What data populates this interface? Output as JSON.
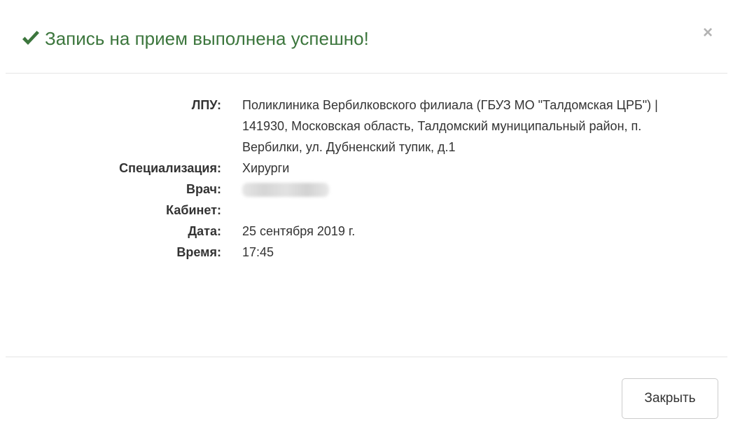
{
  "header": {
    "title": "Запись на прием выполнена успешно!",
    "close_symbol": "×",
    "title_color": "#3c763d"
  },
  "details": {
    "lpu": {
      "label": "ЛПУ:",
      "value": "Поликлиника Вербилковского филиала (ГБУЗ МО \"Талдомская ЦРБ\") | 141930, Московская область, Талдомский муниципальный район, п. Вербилки, ул. Дубненский тупик, д.1"
    },
    "specialization": {
      "label": "Специализация:",
      "value": "Хирурги"
    },
    "doctor": {
      "label": "Врач:"
    },
    "cabinet": {
      "label": "Кабинет:",
      "value": ""
    },
    "date": {
      "label": "Дата:",
      "value": "25 сентября 2019 г."
    },
    "time": {
      "label": "Время:",
      "value": "17:45"
    }
  },
  "footer": {
    "close_button_label": "Закрыть"
  },
  "icons": {
    "title_icon": "check-icon",
    "dismiss_icon": "close-icon"
  }
}
